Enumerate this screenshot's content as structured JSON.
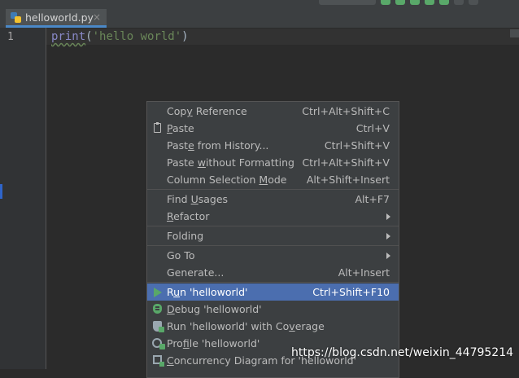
{
  "editor": {
    "tab": {
      "filename": "helloworld.py",
      "close": "×"
    },
    "line_numbers": [
      "1"
    ],
    "code": {
      "keyword": "print",
      "open": "(",
      "string": "'hello world'",
      "close": ")"
    }
  },
  "context_menu": {
    "copy_reference": {
      "label": "Copy Reference",
      "mnemonic": "y",
      "shortcut": "Ctrl+Alt+Shift+C"
    },
    "paste": {
      "label": "Paste",
      "mnemonic": "P",
      "shortcut": "Ctrl+V"
    },
    "paste_history": {
      "label": "Paste from History...",
      "mnemonic": "e",
      "shortcut": "Ctrl+Shift+V"
    },
    "paste_no_format": {
      "label": "Paste without Formatting",
      "mnemonic": "w",
      "shortcut": "Ctrl+Alt+Shift+V"
    },
    "column_selection": {
      "label": "Column Selection Mode",
      "mnemonic": "M",
      "shortcut": "Alt+Shift+Insert"
    },
    "find_usages": {
      "label": "Find Usages",
      "mnemonic": "U",
      "shortcut": "Alt+F7"
    },
    "refactor": {
      "label": "Refactor",
      "mnemonic": "R"
    },
    "folding": {
      "label": "Folding"
    },
    "go_to": {
      "label": "Go To"
    },
    "generate": {
      "label": "Generate...",
      "shortcut": "Alt+Insert"
    },
    "run": {
      "label": "Run 'helloworld'",
      "mnemonic": "u",
      "shortcut": "Ctrl+Shift+F10"
    },
    "debug": {
      "label": "Debug 'helloworld'",
      "mnemonic": "D"
    },
    "coverage": {
      "label": "Run 'helloworld' with Coverage",
      "mnemonic": "v"
    },
    "profile": {
      "label": "Profile 'helloworld'",
      "mnemonic": "f"
    },
    "concurrency": {
      "label": "Concurrency Diagram for 'helloworld'",
      "mnemonic": "C"
    }
  },
  "watermark": "https://blog.csdn.net/weixin_44795214",
  "colors": {
    "selection": "#4b6eaf",
    "run_green": "#59a869",
    "tab_underline": "#4a88c7"
  }
}
